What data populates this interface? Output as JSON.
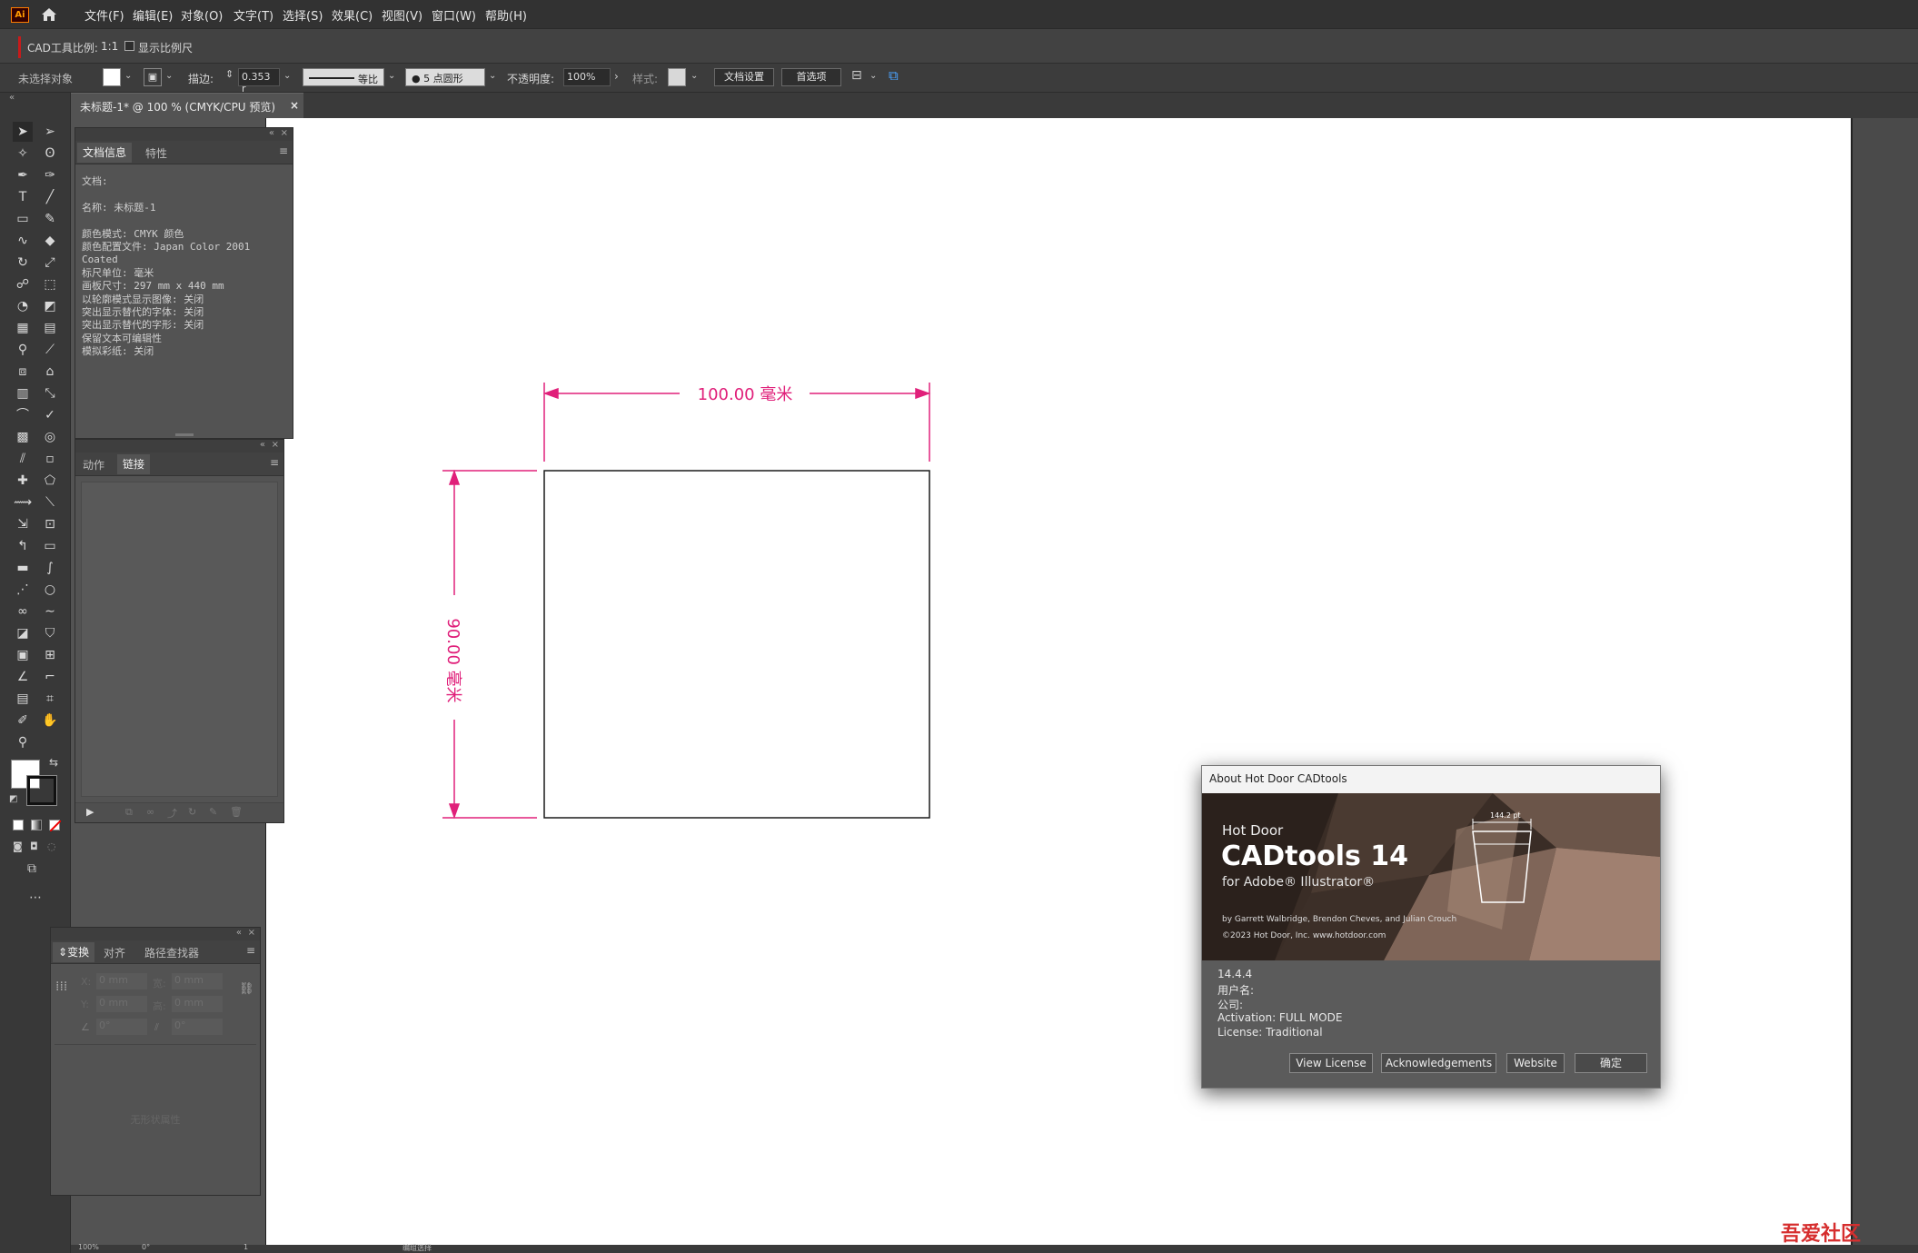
{
  "app": {
    "logo": "Ai"
  },
  "menu": [
    "文件(F)",
    "编辑(E)",
    "对象(O)",
    "文字(T)",
    "选择(S)",
    "效果(C)",
    "视图(V)",
    "窗口(W)",
    "帮助(H)"
  ],
  "cad_bar": {
    "scale_label": "CAD工具比例:",
    "scale_value": "1:1",
    "show_scale": "显示比例尺"
  },
  "control_bar": {
    "selection": "未选择对象",
    "stroke_label": "描边:",
    "stroke_value": "0.353 r",
    "stroke_profile": "等比",
    "brush": "5 点圆形",
    "opacity_label": "不透明度:",
    "opacity_value": "100%",
    "style_label": "样式:",
    "doc_setup": "文档设置",
    "preferences": "首选项"
  },
  "doc_tab": {
    "title": "未标题-1* @ 100 % (CMYK/CPU 预览)",
    "close": "×"
  },
  "doc_info_panel": {
    "tabs": [
      "文档信息",
      "特性"
    ],
    "lines": [
      "文档:",
      "",
      "名称: 未标题-1",
      "",
      "颜色模式: CMYK 颜色",
      "颜色配置文件: Japan Color 2001",
      "Coated",
      "标尺单位: 毫米",
      "画板尺寸: 297 mm x 440 mm",
      "以轮廓模式显示图像: 关闭",
      "突出显示替代的字体: 关闭",
      "突出显示替代的字形: 关闭",
      "保留文本可编辑性",
      "模拟彩纸: 关闭"
    ]
  },
  "links_panel": {
    "tabs": [
      "动作",
      "链接"
    ]
  },
  "transform_panel": {
    "tabs": [
      "变换",
      "对齐",
      "路径查找器"
    ],
    "x_label": "X:",
    "x_value": "0 mm",
    "y_label": "Y:",
    "y_value": "0 mm",
    "w_label": "宽:",
    "w_value": "0 mm",
    "h_label": "高:",
    "h_value": "0 mm",
    "angle_value": "0°",
    "shear_value": "0°",
    "empty_state": "无形状属性"
  },
  "drawing": {
    "width_label": "100.00 毫米",
    "height_label": "90.00 毫米",
    "dim_color": "#e0207a"
  },
  "about_dialog": {
    "title": "About Hot Door CADtools",
    "brand_small": "Hot Door",
    "brand_big": "CADtools 14",
    "brand_sub": "for Adobe® Illustrator®",
    "credits": "by Garrett Walbridge, Brendon Cheves, and Julian Crouch",
    "copyright": "©2023 Hot Door, Inc.    www.hotdoor.com",
    "cup_label": "144.2 pt",
    "version": "14.4.4",
    "user": "用户名:",
    "company": "公司:",
    "activation": "Activation: FULL MODE",
    "license": "License: Traditional",
    "buttons": [
      "View License",
      "Acknowledgements",
      "Website",
      "确定"
    ]
  },
  "status": {
    "zoom": "100%",
    "angle": "0°",
    "page": "1",
    "tool": "编组选择"
  },
  "watermark": "吾爱社区"
}
